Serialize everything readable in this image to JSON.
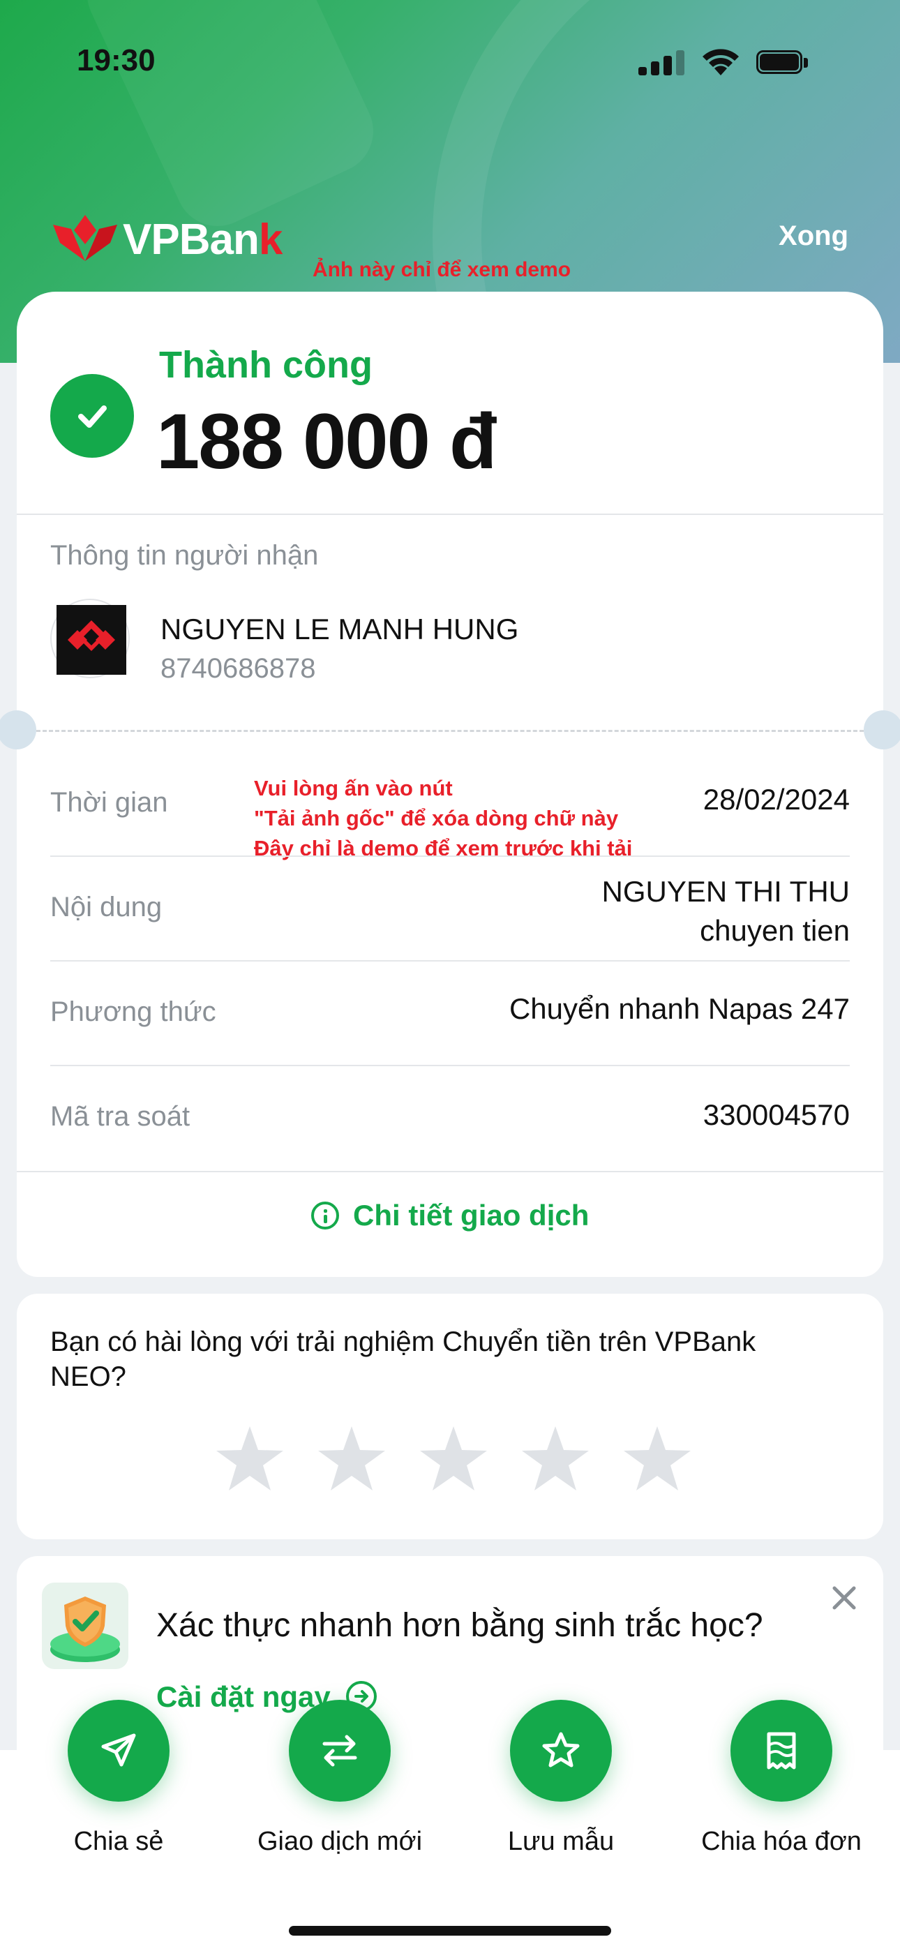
{
  "status_bar": {
    "time": "19:30"
  },
  "header": {
    "brand": "VPBank",
    "done_label": "Xong",
    "watermark": "Ảnh này chỉ để xem demo"
  },
  "result": {
    "status": "Thành công",
    "amount": "188 000 đ"
  },
  "recipient": {
    "section_label": "Thông tin người nhận",
    "name": "NGUYEN LE MANH HUNG",
    "account": "8740686878"
  },
  "details": {
    "demo_note": [
      "Vui lòng ấn vào nút",
      "\"Tải ảnh gốc\" để xóa dòng chữ này",
      "Đây chỉ là demo để xem trước khi tải"
    ],
    "rows": [
      {
        "label": "Thời gian",
        "value": "28/02/2024"
      },
      {
        "label": "Nội dung",
        "value": "NGUYEN THI THU",
        "value2": "chuyen tien"
      },
      {
        "label": "Phương thức",
        "value": "Chuyển nhanh Napas 247"
      },
      {
        "label": "Mã tra soát",
        "value": "330004570"
      }
    ],
    "detail_link": "Chi tiết giao dịch"
  },
  "rating": {
    "question": "Bạn có hài lòng với trải nghiệm Chuyển tiền trên VPBank NEO?",
    "max_stars": 5,
    "selected": 0
  },
  "biometric": {
    "title": "Xác thực nhanh hơn bằng sinh trắc học?",
    "link": "Cài đặt ngay"
  },
  "actions": [
    {
      "label": "Chia sẻ",
      "icon": "send-icon"
    },
    {
      "label": "Giao dịch mới",
      "icon": "swap-icon"
    },
    {
      "label": "Lưu mẫu",
      "icon": "star-icon"
    },
    {
      "label": "Chia hóa đơn",
      "icon": "receipt-icon"
    }
  ],
  "colors": {
    "primary": "#14a94b",
    "brand_red": "#e8202a"
  }
}
